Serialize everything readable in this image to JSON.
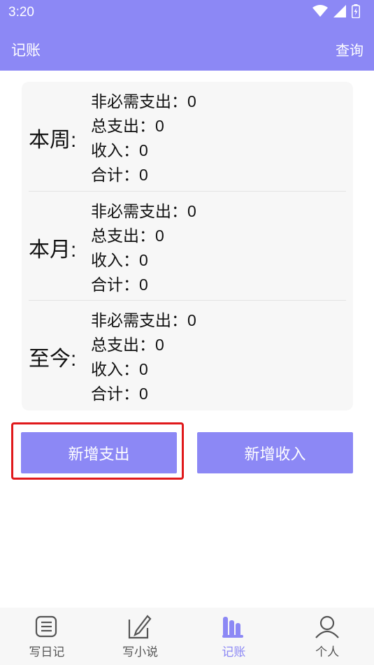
{
  "status": {
    "time": "3:20"
  },
  "header": {
    "title": "记账",
    "query_label": "查询"
  },
  "summary": [
    {
      "period": "本周:",
      "lines": [
        "非必需支出：0",
        "总支出：0",
        "收入：0",
        "合计：0"
      ]
    },
    {
      "period": "本月:",
      "lines": [
        "非必需支出：0",
        "总支出：0",
        "收入：0",
        "合计：0"
      ]
    },
    {
      "period": "至今:",
      "lines": [
        "非必需支出：0",
        "总支出：0",
        "收入：0",
        "合计：0"
      ]
    }
  ],
  "actions": {
    "add_expense": "新增支出",
    "add_income": "新增收入"
  },
  "nav": [
    {
      "label": "写日记",
      "icon": "diary-icon",
      "active": false
    },
    {
      "label": "写小说",
      "icon": "novel-icon",
      "active": false
    },
    {
      "label": "记账",
      "icon": "accounting-icon",
      "active": true
    },
    {
      "label": "个人",
      "icon": "person-icon",
      "active": false
    }
  ],
  "colors": {
    "accent": "#8c88f5",
    "highlight": "#e0191b",
    "card_bg": "#f7f7f7"
  }
}
